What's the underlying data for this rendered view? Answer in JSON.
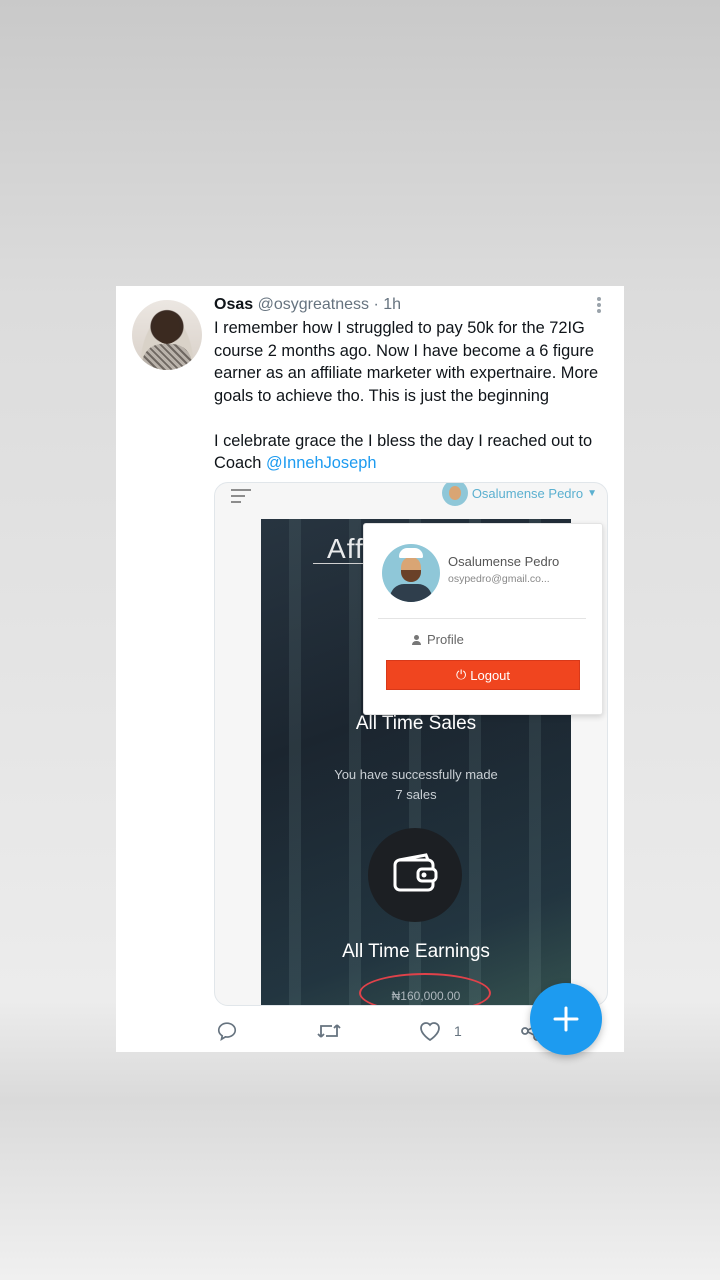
{
  "tweet": {
    "author_name": "Osas",
    "handle": "@osygreatness",
    "separator": "·",
    "time": "1h",
    "paragraph1": "I remember how I struggled to pay 50k for the 72IG course 2 months ago. Now I have become a 6 figure earner as an affiliate marketer with expertnaire. More goals to achieve tho. This is just the beginning",
    "paragraph2_prefix": "I celebrate grace the I bless the day I reached out to Coach ",
    "mention": "@InnehJoseph",
    "like_count": "1"
  },
  "media": {
    "top_user_name": "Osalumense Pedro",
    "stats_title": "Affiliate Stats",
    "sales_title": "All Time Sales",
    "sales_line1": "You have successfully made",
    "sales_line2": "7 sales",
    "earnings_title": "All Time Earnings",
    "earnings_value": "₦160,000.00",
    "dropdown": {
      "name": "Osalumense Pedro",
      "email": "osypedro@gmail.co...",
      "profile_label": "Profile",
      "logout_label": "Logout"
    }
  },
  "icons": {
    "more": "more-vertical-icon",
    "reply": "reply-icon",
    "retweet": "retweet-icon",
    "like": "heart-icon",
    "share": "share-icon",
    "compose": "plus-icon",
    "wallet": "wallet-icon"
  },
  "colors": {
    "accent": "#1d9bf0",
    "logout": "#f0451f",
    "highlight_ring": "#e0424a"
  }
}
